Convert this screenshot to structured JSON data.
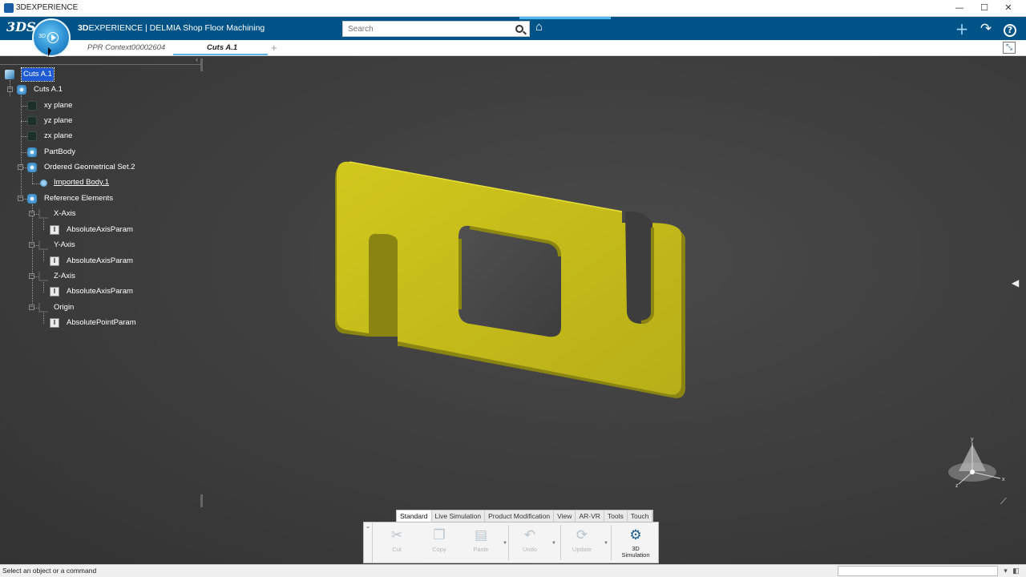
{
  "window": {
    "title": "3DEXPERIENCE",
    "minimize": "—",
    "maximize": "☐",
    "close": "✕"
  },
  "header": {
    "brand_bold": "3D",
    "brand_rest": "EXPERIENCE | DELMIA Shop Floor Machining",
    "search_placeholder": "Search",
    "logo_text": "3DS",
    "compass_label": "3D"
  },
  "tabs": [
    {
      "label": "PPR Context00002604"
    },
    {
      "label": "Cuts A.1"
    }
  ],
  "add_tab": "+",
  "tree": {
    "collapse_arrow": "‹",
    "root": "Cuts A.1",
    "part": "Cuts A.1",
    "items": [
      {
        "label": "xy plane"
      },
      {
        "label": "yz plane"
      },
      {
        "label": "zx plane"
      },
      {
        "label": "PartBody"
      },
      {
        "label": "Ordered Geometrical Set.2"
      },
      {
        "label": "Imported Body.1"
      },
      {
        "label": "Reference Elements"
      },
      {
        "label": "X-Axis"
      },
      {
        "label": "AbsoluteAxisParam"
      },
      {
        "label": "Y-Axis"
      },
      {
        "label": "AbsoluteAxisParam"
      },
      {
        "label": "Z-Axis"
      },
      {
        "label": "AbsoluteAxisParam"
      },
      {
        "label": "Origin"
      },
      {
        "label": "AbsolutePointParam"
      }
    ]
  },
  "actionbar": {
    "tabs": [
      "Standard",
      "Live Simulation",
      "Product Modification",
      "View",
      "AR-VR",
      "Tools",
      "Touch"
    ],
    "active_tab": "Standard",
    "buttons": {
      "cut": "Cut",
      "copy": "Copy",
      "paste": "Paste",
      "undo": "Undo",
      "update": "Update",
      "sim_line1": "3D",
      "sim_line2": "Simulation"
    }
  },
  "axis_widget": {
    "x": "x",
    "y": "y",
    "z": "z"
  },
  "statusbar": {
    "message": "Select an object or a command"
  },
  "colors": {
    "header_blue": "#005386",
    "part_yellow": "#c9c21d",
    "selection_blue": "#1e5ad4"
  }
}
